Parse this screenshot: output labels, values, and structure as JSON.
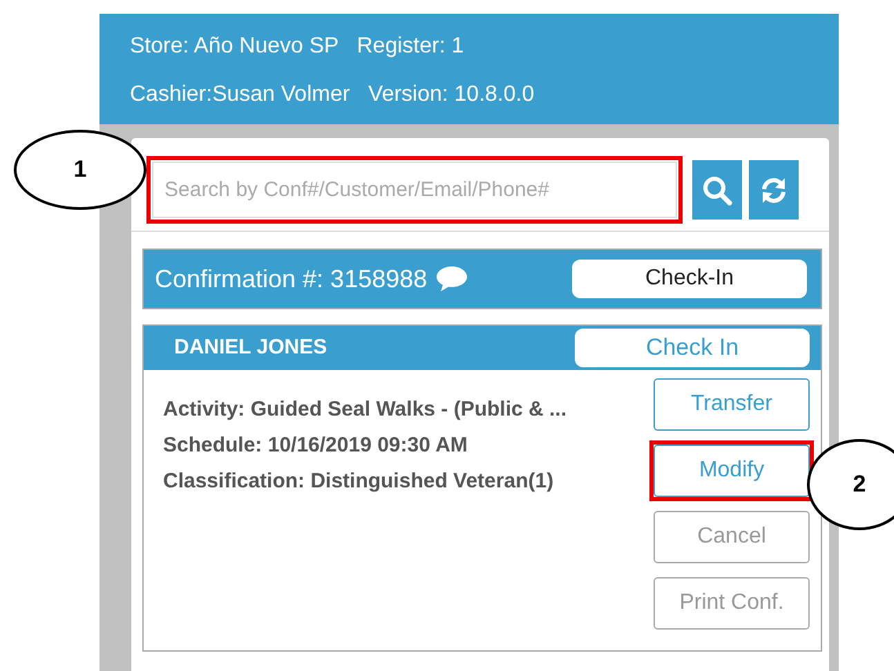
{
  "header": {
    "lines": [
      "Store: Año Nuevo SP   Register: 1",
      "Cashier:Susan Volmer   Version: 10.8.0.0"
    ]
  },
  "search": {
    "placeholder": "Search by Conf#/Customer/Email/Phone#",
    "highlighted": true
  },
  "confirmation": {
    "label": "Confirmation #: 3158988",
    "button": "Check-In"
  },
  "guest": {
    "name": "DANIEL JONES",
    "button": "Check In",
    "details": [
      "Activity: Guided Seal Walks - (Public & ...",
      "Schedule: 10/16/2019 09:30 AM",
      "Classification: Distinguished Veteran(1)"
    ],
    "actions": [
      {
        "label": "Transfer",
        "disabled": false,
        "highlighted": false
      },
      {
        "label": "Modify",
        "disabled": false,
        "highlighted": true
      },
      {
        "label": "Cancel",
        "disabled": true,
        "highlighted": false
      },
      {
        "label": "Print Conf.",
        "disabled": true,
        "highlighted": false
      }
    ]
  },
  "callouts": [
    {
      "label": "1"
    },
    {
      "label": "2"
    }
  ]
}
